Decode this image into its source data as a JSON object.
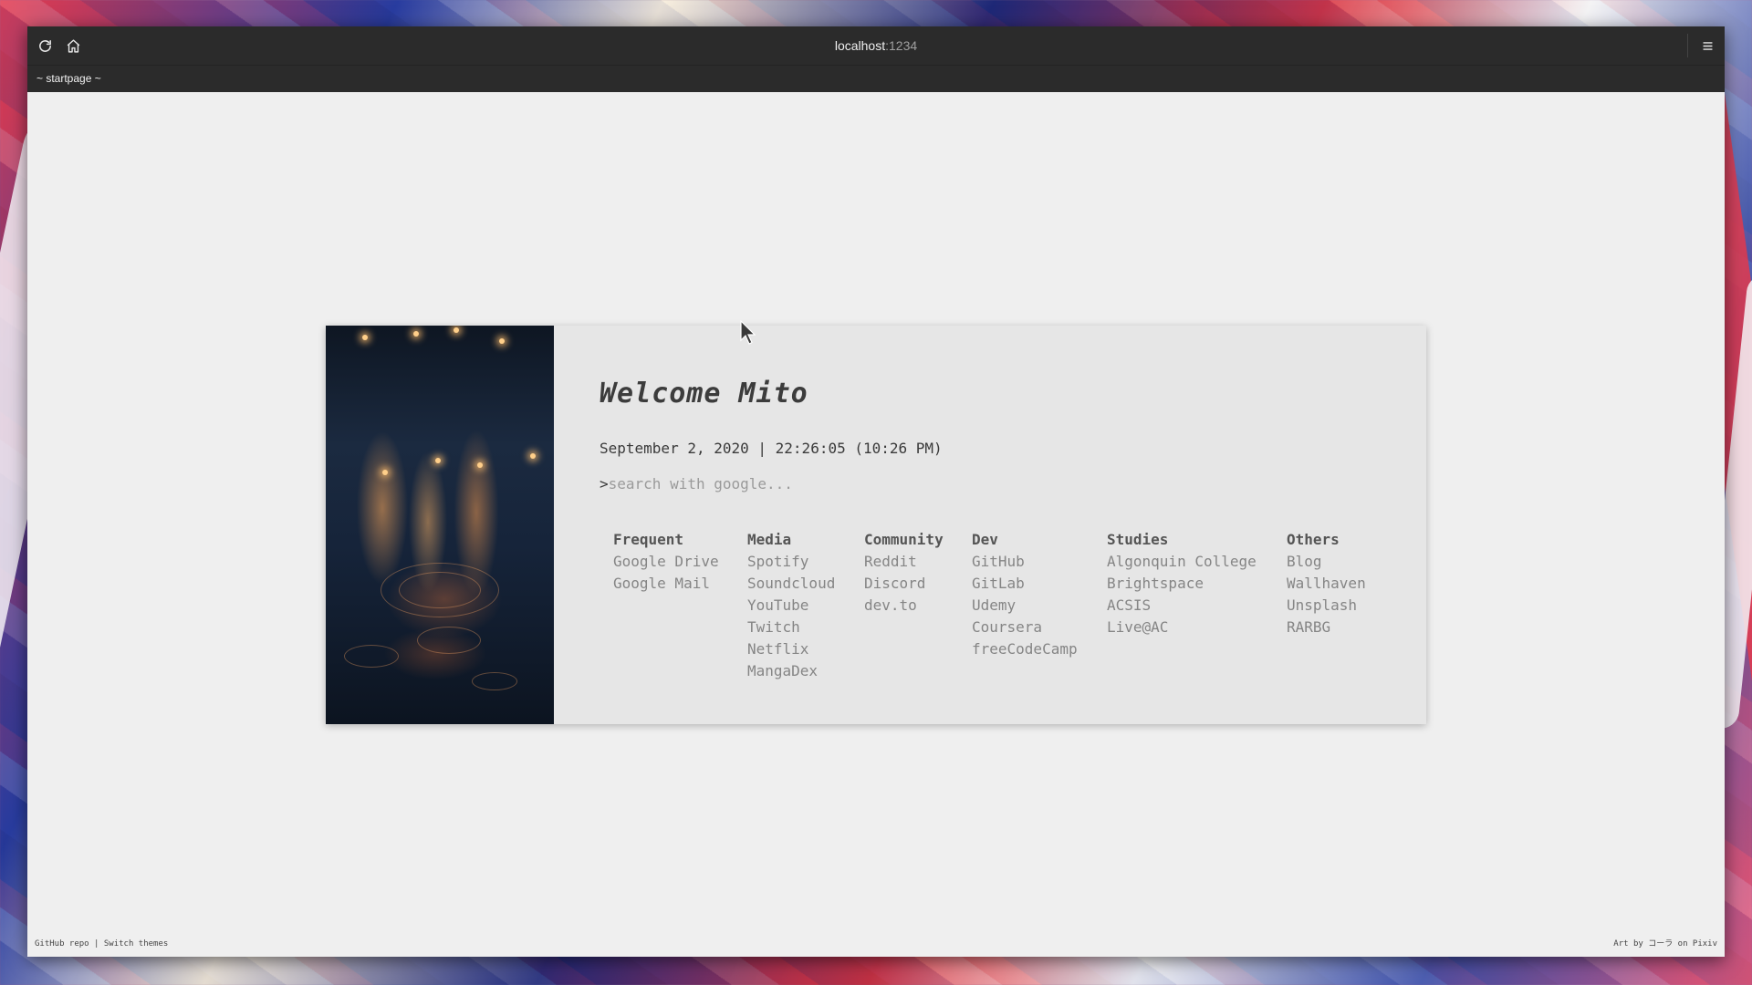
{
  "browser": {
    "url_host": "localhost",
    "url_port": ":1234",
    "tab_title": "~ startpage ~"
  },
  "startpage": {
    "welcome": "Welcome Mito",
    "datetime": "September 2, 2020 | 22:26:05 (10:26 PM)",
    "search_prompt": ">",
    "search_placeholder": "search with google...",
    "columns": [
      {
        "title": "Frequent",
        "links": [
          "Google Drive",
          "Google Mail"
        ]
      },
      {
        "title": "Media",
        "links": [
          "Spotify",
          "Soundcloud",
          "YouTube",
          "Twitch",
          "Netflix",
          "MangaDex"
        ]
      },
      {
        "title": "Community",
        "links": [
          "Reddit",
          "Discord",
          "dev.to"
        ]
      },
      {
        "title": "Dev",
        "links": [
          "GitHub",
          "GitLab",
          "Udemy",
          "Coursera",
          "freeCodeCamp"
        ]
      },
      {
        "title": "Studies",
        "links": [
          "Algonquin College",
          "Brightspace",
          "ACSIS",
          "Live@AC"
        ]
      },
      {
        "title": "Others",
        "links": [
          "Blog",
          "Wallhaven",
          "Unsplash",
          "RARBG"
        ]
      }
    ]
  },
  "footer": {
    "github_repo": "GitHub repo",
    "separator": "|",
    "switch_themes": "Switch themes",
    "art_credit": "Art by コーラ on Pixiv"
  },
  "colors": {
    "toolbar_bg": "#2b2b2b",
    "page_bg": "#efefef",
    "card_bg": "#e6e6e6",
    "heading": "#3c3c3c",
    "link": "#858585"
  }
}
